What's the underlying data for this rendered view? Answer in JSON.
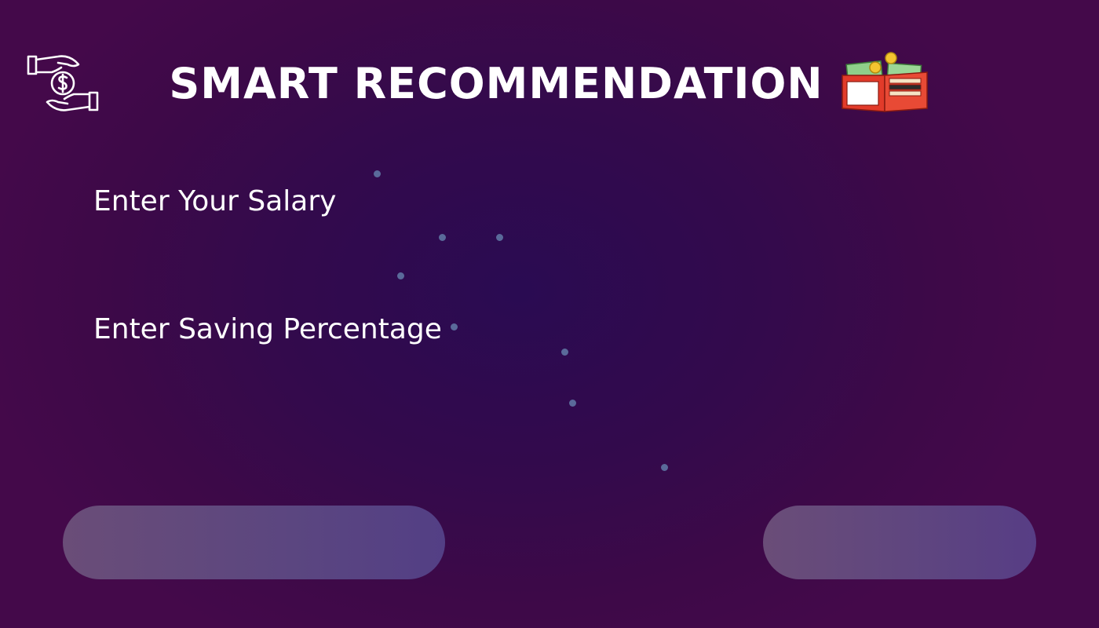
{
  "header": {
    "title": "SMART RECOMMENDATION",
    "logo_icon": "money-in-hands-icon",
    "wallet_icon": "wallet-with-cash-icon"
  },
  "form": {
    "salary_label": "Enter Your Salary",
    "saving_label": "Enter Saving Percentage"
  },
  "buttons": {
    "left_label": "",
    "right_label": ""
  },
  "colors": {
    "background": "#330a4c",
    "text": "#ffffff",
    "dots": "#5a6a9a",
    "pill_start": "#6a4d78",
    "pill_end": "#533f85",
    "wallet_red": "#e23b2a"
  }
}
